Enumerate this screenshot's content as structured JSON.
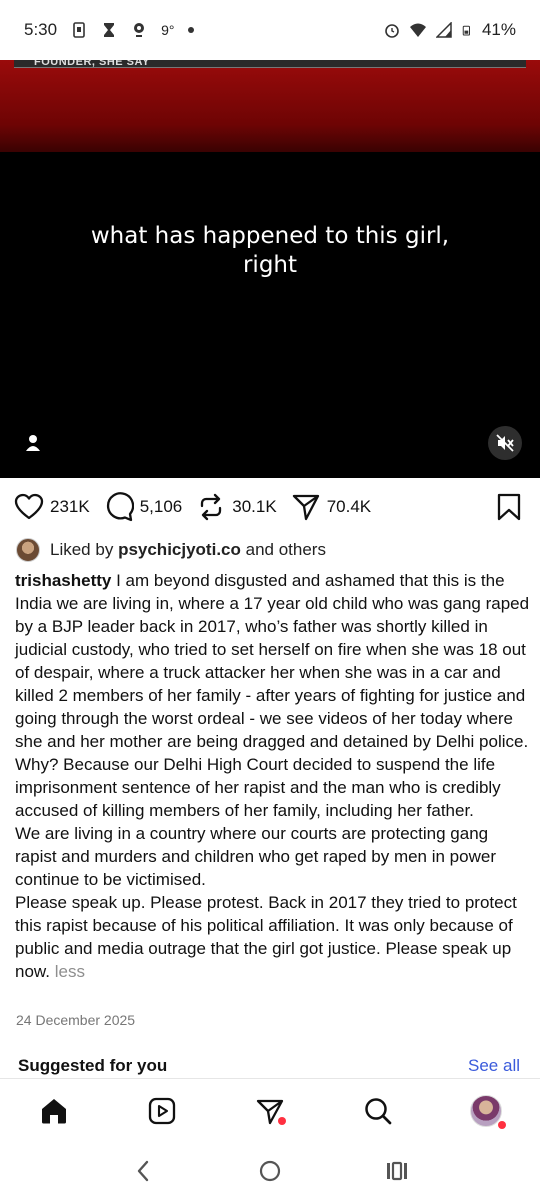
{
  "status_bar": {
    "time": "5:30",
    "temperature": "9°",
    "battery": "41%",
    "icons": [
      "sim-icon",
      "hourglass-icon",
      "location-icon",
      "dot-icon",
      "alarm-icon",
      "wifi-icon",
      "signal-icon",
      "battery-icon"
    ]
  },
  "video": {
    "top_strip_text": "FOUNDER, SHE SAY",
    "caption_line1": "what has happened to this girl,",
    "caption_line2": "right"
  },
  "actions": {
    "likes": "231K",
    "comments": "5,106",
    "reposts": "30.1K",
    "shares": "70.4K"
  },
  "liked_by": {
    "prefix": "Liked by",
    "user": "psychicjyoti.co",
    "suffix": "and others"
  },
  "post": {
    "username": "trishashetty",
    "paragraph1": "I am beyond disgusted and ashamed that this is the India we are living in, where a 17 year old child who was gang raped by a BJP leader back in 2017, who’s father was shortly killed in judicial custody, who tried to set herself on fire when she was 18 out of despair, where a truck attacker her when she was in a car and killed 2 members of her family - after years of fighting for justice and going through the worst ordeal - we see videos of her today where she and her mother are being dragged and detained by Delhi police. Why? Because our Delhi High Court decided to suspend the life imprisonment sentence of her rapist and the man who is credibly accused of killing members of her family, including her father.",
    "paragraph2": "We are living in a country where our courts are protecting gang rapist and murders and children who get raped by men in power continue to be victimised.",
    "paragraph3": "Please speak up. Please protest. Back in 2017 they tried to protect this rapist because of his political affiliation. It was only because of public and media outrage that the girl got justice. Please speak up now.",
    "less_label": "less",
    "date": "24 December 2025"
  },
  "suggested": {
    "title": "Suggested for you",
    "see_all": "See all"
  },
  "colors": {
    "accent_link": "#3b5bdb",
    "notification_dot": "#ff3040",
    "video_red": "#9a0b0b"
  }
}
